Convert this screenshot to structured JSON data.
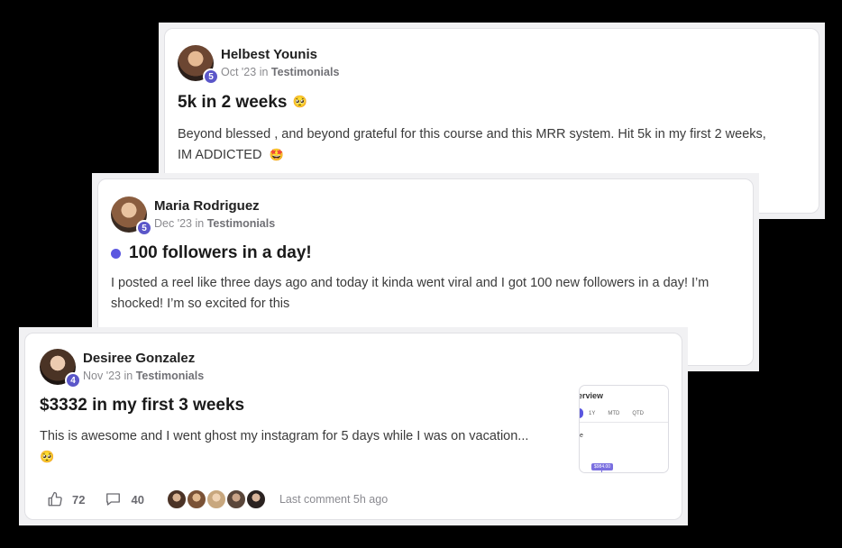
{
  "posts": [
    {
      "author": "Helbest Younis",
      "level": "5",
      "date": "Oct '23",
      "in_word": "in",
      "category": "Testimonials",
      "title": "5k in 2 weeks",
      "title_emoji": "pleading-face",
      "title_emoji_char": "🥺",
      "body_line1": "Beyond blessed , and beyond grateful for this course and this MRR system. Hit 5k in my first 2 weeks,",
      "body_line2": "IM ADDICTED",
      "body_emoji": "star-struck",
      "body_emoji_char": "🤩"
    },
    {
      "author": "Maria Rodriguez",
      "level": "5",
      "date": "Dec '23",
      "in_word": "in",
      "category": "Testimonials",
      "unread": true,
      "title": "100 followers in a day!",
      "body_line1": "I posted a reel like three days ago and today it kinda went viral and I got 100 new followers in a day! I’m",
      "body_line2": "shocked! I’m so excited for this"
    },
    {
      "author": "Desiree Gonzalez",
      "level": "4",
      "date": "Nov '23",
      "in_word": "in",
      "category": "Testimonials",
      "title": "$3332 in my first 3 weeks",
      "body_line1": "This is awesome and I went ghost my instagram for 5 days while I was on vacation...",
      "body_emoji": "pleading-face",
      "body_emoji_char": "🥺",
      "thumbnail": {
        "title": "erview",
        "tabs": [
          "1Y",
          "MTD",
          "QTD"
        ],
        "mark": "e",
        "value": "$984.00"
      },
      "likes": "72",
      "comments": "40",
      "last_comment": "Last comment 5h ago"
    }
  ],
  "colors": {
    "accent": "#5b57e0",
    "badge": "#5b57c9",
    "card_bg": "#ffffff",
    "page_bg": "#000000"
  },
  "icons": {
    "like": "thumbs-up-icon",
    "comment": "comment-bubble-icon"
  }
}
